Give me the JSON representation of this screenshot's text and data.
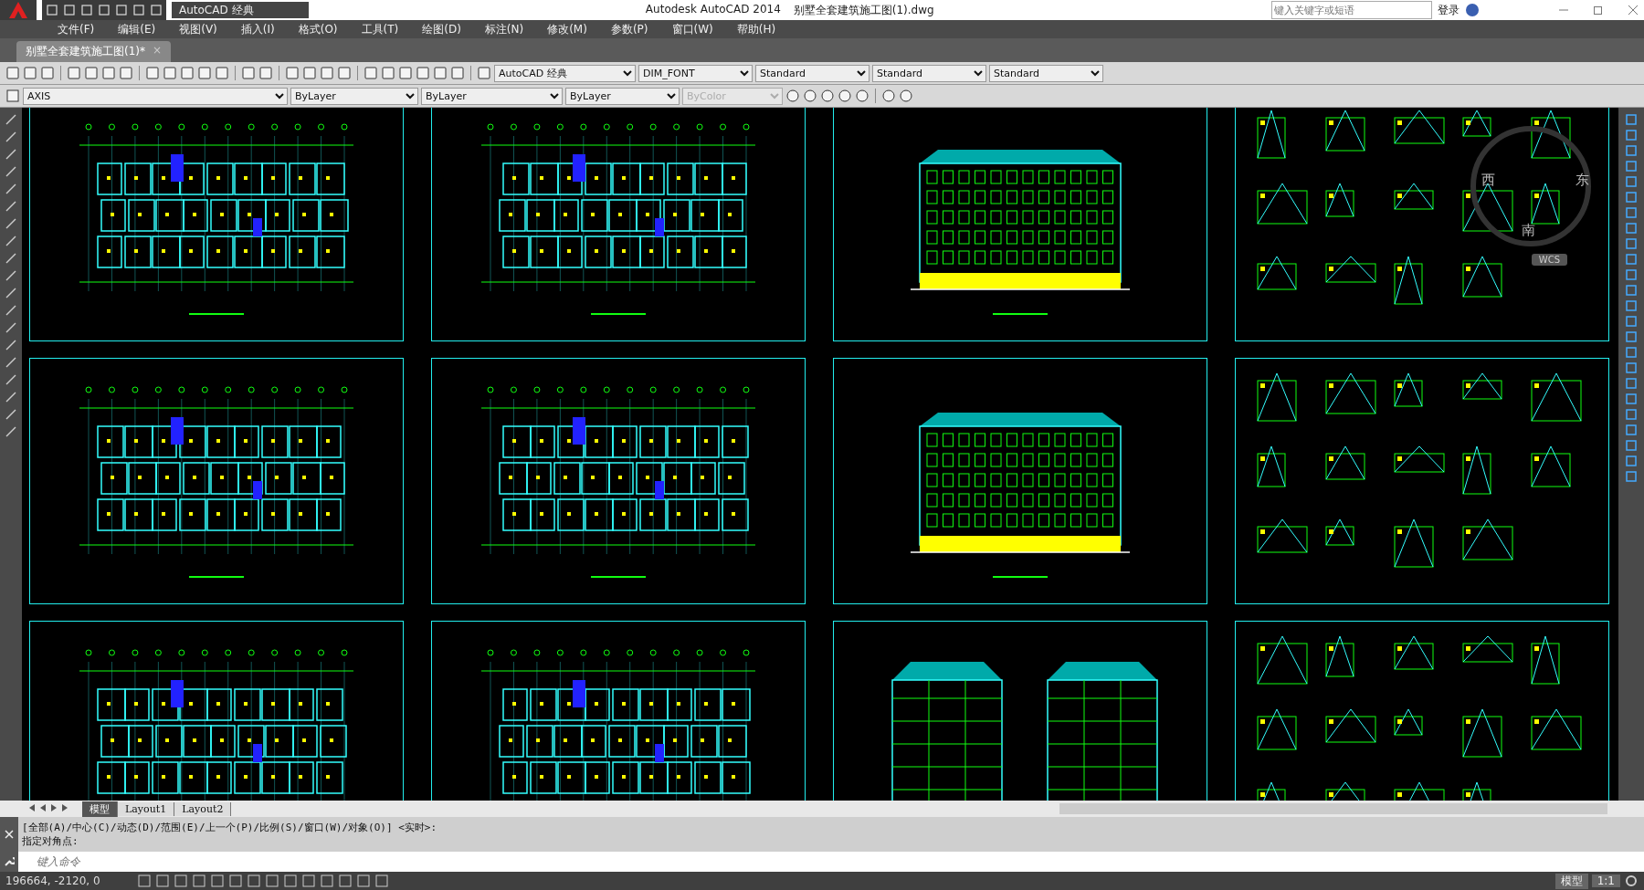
{
  "title_bar": {
    "workspace": "AutoCAD 经典",
    "app_title": "Autodesk AutoCAD 2014",
    "file_name": "别墅全套建筑施工图(1).dwg",
    "search": {
      "placeholder": "键入关键字或短语"
    },
    "login": "登录"
  },
  "menu": [
    "文件(F)",
    "编辑(E)",
    "视图(V)",
    "插入(I)",
    "格式(O)",
    "工具(T)",
    "绘图(D)",
    "标注(N)",
    "修改(M)",
    "参数(P)",
    "窗口(W)",
    "帮助(H)"
  ],
  "doc_tab": {
    "label": "别墅全套建筑施工图(1)*",
    "close": "×"
  },
  "toolbar": {
    "workspace": "AutoCAD 经典",
    "text_style": "DIM_FONT",
    "dim_style": "Standard",
    "table_style": "Standard",
    "mleader_style": "Standard"
  },
  "layers": {
    "layer": "AXIS",
    "color_control": "ByLayer",
    "linetype": "ByLayer",
    "lineweight": "ByLayer",
    "plot_style": "ByColor"
  },
  "sheets": [
    {
      "kind": "plan"
    },
    {
      "kind": "plan"
    },
    {
      "kind": "elevation"
    },
    {
      "kind": "details"
    },
    {
      "kind": "plan"
    },
    {
      "kind": "plan"
    },
    {
      "kind": "elevation"
    },
    {
      "kind": "details"
    },
    {
      "kind": "plan"
    },
    {
      "kind": "plan"
    },
    {
      "kind": "side_elevations"
    },
    {
      "kind": "details"
    }
  ],
  "viewcube": {
    "west": "西",
    "east": "东",
    "south": "南",
    "ucs": "WCS"
  },
  "layout_tabs": [
    {
      "label": "模型",
      "selected": true
    },
    {
      "label": "Layout1",
      "selected": false
    },
    {
      "label": "Layout2",
      "selected": false
    }
  ],
  "command": {
    "history": [
      "[全部(A)/中心(C)/动态(D)/范围(E)/上一个(P)/比例(S)/窗口(W)/对象(O)] <实时>:",
      "指定对角点:"
    ],
    "placeholder": "键入命令"
  },
  "status_bar": {
    "coordinates": "196664, -2120, 0",
    "space": "模型",
    "scale": "1:1"
  }
}
